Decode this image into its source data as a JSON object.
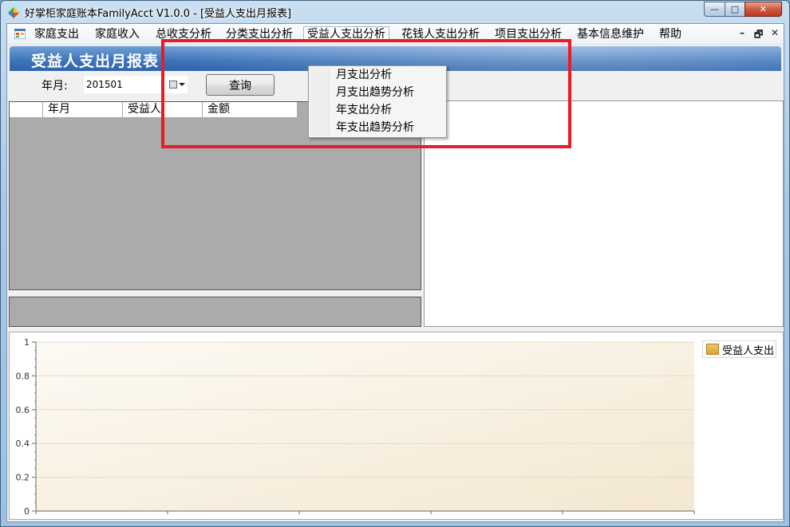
{
  "window": {
    "title": "好掌柜家庭账本FamilyAcct V1.0.0 - [受益人支出月报表]",
    "controls": {
      "minimize": "—",
      "maximize": "□",
      "close": "✕"
    }
  },
  "menubar": {
    "items": [
      {
        "label": "家庭支出"
      },
      {
        "label": "家庭收入"
      },
      {
        "label": "总收支分析"
      },
      {
        "label": "分类支出分析"
      },
      {
        "label": "受益人支出分析"
      },
      {
        "label": "花钱人支出分析"
      },
      {
        "label": "项目支出分析"
      },
      {
        "label": "基本信息维护"
      },
      {
        "label": "帮助"
      }
    ],
    "mdi_controls": {
      "minimize": "–",
      "restore": "🗗",
      "close": "✕"
    }
  },
  "dropdown": {
    "items": [
      {
        "label": "月支出分析"
      },
      {
        "label": "月支出趋势分析"
      },
      {
        "label": "年支出分析"
      },
      {
        "label": "年支出趋势分析"
      }
    ]
  },
  "report": {
    "title": "受益人支出月报表",
    "filter_label": "年月:",
    "date_value": "201501",
    "query_label": "查询"
  },
  "grid": {
    "columns": [
      "年月",
      "受益人",
      "金额"
    ]
  },
  "chart_data": {
    "type": "bar",
    "categories": [],
    "series": [
      {
        "name": "受益人支出",
        "values": []
      }
    ],
    "ylim": [
      0,
      1
    ],
    "yticks": [
      "0",
      "0.2",
      "0.4",
      "0.6",
      "0.8",
      "1"
    ],
    "grid": true,
    "legend": "top-right",
    "colors": {
      "series": "#e0a940",
      "plot_bg": "#f6eddc"
    }
  }
}
